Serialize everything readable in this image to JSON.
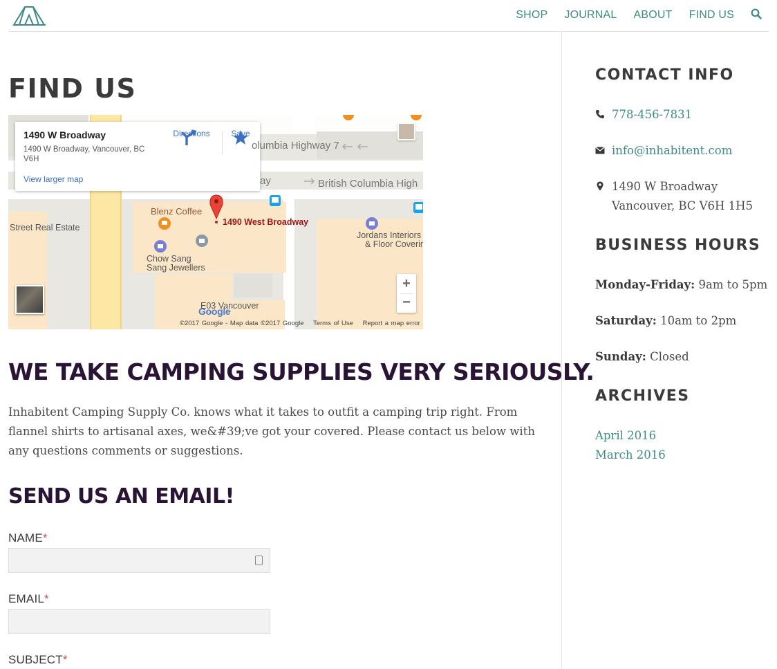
{
  "nav": {
    "items": [
      "SHOP",
      "JOURNAL",
      "ABOUT",
      "FIND US"
    ]
  },
  "page": {
    "title": "FIND US"
  },
  "map": {
    "card": {
      "place": "1490 W Broadway",
      "address": "1490 W Broadway, Vancouver, BC V6H",
      "directions": "Directions",
      "save": "Save",
      "larger_map": "View larger map"
    },
    "labels": {
      "highway_top": "olumbia Highway 7",
      "highway_mid": "British Columbia High",
      "highway_mid_left": "ay",
      "blenz": "Blenz Coffee",
      "pin": "1490 West Broadway",
      "real_estate": "Street Real Estate",
      "chow_sang": "Chow Sang",
      "jewellers": "Sang Jewellers",
      "jordans": "Jordans Interiors",
      "floor": "& Floor Covering",
      "e03": "E03 Vancouver",
      "google": "Google"
    },
    "attribution": [
      "©2017 Google - Map data ©2017 Google",
      "Terms of Use",
      "Report a map error"
    ]
  },
  "main": {
    "headline": "WE TAKE CAMPING SUPPLIES VERY SERIOUSLY.",
    "intro": "Inhabitent Camping Supply Co. knows what it takes to outfit a camping trip right. From flannel shirts to artisanal axes, we&#39;ve got your covered. Please contact us below with any questions comments or suggestions.",
    "email_title": "SEND US AN EMAIL!"
  },
  "form": {
    "name_label": "NAME",
    "email_label": "EMAIL",
    "subject_label": "SUBJECT",
    "required_mark": "*"
  },
  "sidebar": {
    "contact_title": "CONTACT INFO",
    "phone": "778-456-7831",
    "email": "info@inhabitent.com",
    "address_line1": "1490 W Broadway",
    "address_line2": "Vancouver, BC V6H 1H5",
    "hours_title": "BUSINESS HOURS",
    "hours": [
      {
        "day": "Monday-Friday:",
        "time": "9am to 5pm"
      },
      {
        "day": "Saturday:",
        "time": "10am to 2pm"
      },
      {
        "day": "Sunday:",
        "time": "Closed"
      }
    ],
    "archives_title": "ARCHIVES",
    "archives": [
      "April 2016",
      "March 2016"
    ]
  },
  "colors": {
    "accent": "#3d8b84",
    "headline": "#2a1436",
    "required": "#c0533a"
  }
}
